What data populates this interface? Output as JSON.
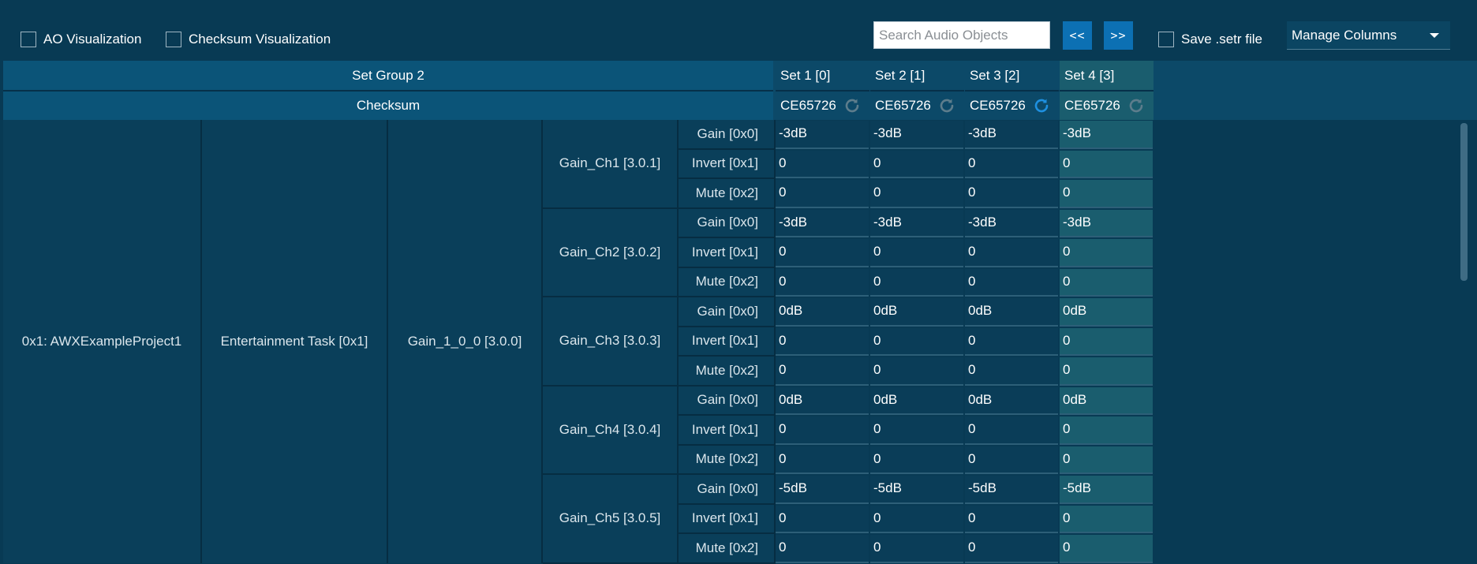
{
  "toolbar": {
    "ao_visualization_label": "AO Visualization",
    "checksum_visualization_label": "Checksum Visualization",
    "search_placeholder": "Search Audio Objects",
    "prev_label": "<<",
    "next_label": ">>",
    "save_setr_label": "Save .setr file",
    "manage_columns_label": "Manage Columns"
  },
  "header": {
    "set_group_label": "Set Group 2",
    "checksum_label": "Checksum"
  },
  "sets": [
    {
      "name": "Set 1 [0]",
      "checksum": "CE65726",
      "refresh_state": "disabled"
    },
    {
      "name": "Set 2 [1]",
      "checksum": "CE65726",
      "refresh_state": "disabled"
    },
    {
      "name": "Set 3 [2]",
      "checksum": "CE65726",
      "refresh_state": "active"
    },
    {
      "name": "Set 4 [3]",
      "checksum": "CE65726",
      "refresh_state": "disabled"
    }
  ],
  "colors": {
    "refresh_active": "#1e90e0",
    "refresh_disabled": "#5d7d8c",
    "selected_column": "#1a5d6e"
  },
  "tree": {
    "project": "0x1: AWXExampleProject1",
    "task": "Entertainment Task [0x1]",
    "module": "Gain_1_0_0 [3.0.0]"
  },
  "channels": [
    {
      "name": "Gain_Ch1 [3.0.1]",
      "params": [
        {
          "label": "Gain [0x0]",
          "values": [
            "-3dB",
            "-3dB",
            "-3dB",
            "-3dB"
          ]
        },
        {
          "label": "Invert [0x1]",
          "values": [
            "0",
            "0",
            "0",
            "0"
          ]
        },
        {
          "label": "Mute [0x2]",
          "values": [
            "0",
            "0",
            "0",
            "0"
          ]
        }
      ]
    },
    {
      "name": "Gain_Ch2 [3.0.2]",
      "params": [
        {
          "label": "Gain [0x0]",
          "values": [
            "-3dB",
            "-3dB",
            "-3dB",
            "-3dB"
          ]
        },
        {
          "label": "Invert [0x1]",
          "values": [
            "0",
            "0",
            "0",
            "0"
          ]
        },
        {
          "label": "Mute [0x2]",
          "values": [
            "0",
            "0",
            "0",
            "0"
          ]
        }
      ]
    },
    {
      "name": "Gain_Ch3 [3.0.3]",
      "params": [
        {
          "label": "Gain [0x0]",
          "values": [
            "0dB",
            "0dB",
            "0dB",
            "0dB"
          ]
        },
        {
          "label": "Invert [0x1]",
          "values": [
            "0",
            "0",
            "0",
            "0"
          ]
        },
        {
          "label": "Mute [0x2]",
          "values": [
            "0",
            "0",
            "0",
            "0"
          ]
        }
      ]
    },
    {
      "name": "Gain_Ch4 [3.0.4]",
      "params": [
        {
          "label": "Gain [0x0]",
          "values": [
            "0dB",
            "0dB",
            "0dB",
            "0dB"
          ]
        },
        {
          "label": "Invert [0x1]",
          "values": [
            "0",
            "0",
            "0",
            "0"
          ]
        },
        {
          "label": "Mute [0x2]",
          "values": [
            "0",
            "0",
            "0",
            "0"
          ]
        }
      ]
    },
    {
      "name": "Gain_Ch5 [3.0.5]",
      "params": [
        {
          "label": "Gain [0x0]",
          "values": [
            "-5dB",
            "-5dB",
            "-5dB",
            "-5dB"
          ]
        },
        {
          "label": "Invert [0x1]",
          "values": [
            "0",
            "0",
            "0",
            "0"
          ]
        },
        {
          "label": "Mute [0x2]",
          "values": [
            "0",
            "0",
            "0",
            "0"
          ]
        }
      ]
    }
  ]
}
